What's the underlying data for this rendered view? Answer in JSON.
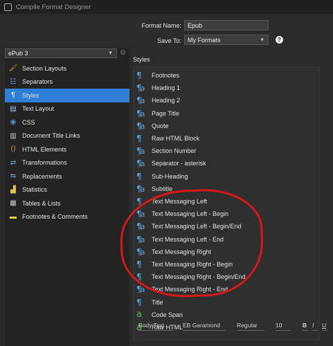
{
  "window": {
    "title": "Compile Format Designer"
  },
  "form": {
    "format_name_label": "Format Name:",
    "format_name_value": "Epub",
    "save_to_label": "Save To:",
    "save_to_value": "My Formats",
    "help_label": "?"
  },
  "sidebar": {
    "format_selected": "ePub 3",
    "items": [
      {
        "label": "Section Layouts",
        "icon": "paint-brush-icon"
      },
      {
        "label": "Separators",
        "icon": "separator-icon"
      },
      {
        "label": "Styles",
        "icon": "styles-icon"
      },
      {
        "label": "Text Layout",
        "icon": "text-layout-icon"
      },
      {
        "label": "CSS",
        "icon": "css-icon"
      },
      {
        "label": "Document Title Links",
        "icon": "document-links-icon"
      },
      {
        "label": "HTML Elements",
        "icon": "html-elements-icon"
      },
      {
        "label": "Transformations",
        "icon": "transformations-icon"
      },
      {
        "label": "Replacements",
        "icon": "replacements-icon"
      },
      {
        "label": "Statistics",
        "icon": "statistics-icon"
      },
      {
        "label": "Tables & Lists",
        "icon": "tables-icon"
      },
      {
        "label": "Footnotes & Comments",
        "icon": "footnotes-icon"
      }
    ]
  },
  "styles": {
    "heading": "Styles",
    "items": [
      {
        "label": "Footnotes",
        "kind": "paragraph"
      },
      {
        "label": "Heading 1",
        "kind": "paragraph-character"
      },
      {
        "label": "Heading 2",
        "kind": "paragraph-character"
      },
      {
        "label": "Page Title",
        "kind": "paragraph-character"
      },
      {
        "label": "Quote",
        "kind": "paragraph-character"
      },
      {
        "label": "Raw HTML Block",
        "kind": "paragraph"
      },
      {
        "label": "Section Number",
        "kind": "paragraph-character"
      },
      {
        "label": "Separator - asterisk",
        "kind": "paragraph-character"
      },
      {
        "label": "Sub-Heading",
        "kind": "paragraph"
      },
      {
        "label": "Subtitle",
        "kind": "paragraph-character"
      },
      {
        "label": "Text Messaging Left",
        "kind": "paragraph"
      },
      {
        "label": "Text Messaging Left - Begin",
        "kind": "paragraph-character"
      },
      {
        "label": "Text Messaging Left - Begin/End",
        "kind": "paragraph-character"
      },
      {
        "label": "Text Messaging Left - End",
        "kind": "paragraph-character"
      },
      {
        "label": "Text Messaging Right",
        "kind": "paragraph-character"
      },
      {
        "label": "Text Messaging Right - Begin",
        "kind": "paragraph"
      },
      {
        "label": "Text Messaging Right - Begin/End",
        "kind": "paragraph"
      },
      {
        "label": "Text Messaging Right - End",
        "kind": "paragraph-character"
      },
      {
        "label": "Title",
        "kind": "paragraph"
      },
      {
        "label": "Code Span",
        "kind": "character"
      },
      {
        "label": "Raw HTML",
        "kind": "character"
      }
    ]
  },
  "toolbar": {
    "style_name": "Body Text",
    "font": "EB Garamond",
    "weight": "Regular",
    "size": "10",
    "bold": "B",
    "italic": "I",
    "underline": "U"
  },
  "colors": {
    "selection": "#2f7fd6",
    "paragraph_icon": "#5aa2dc",
    "character_icon": "#54b84c",
    "annotation": "#d8181a"
  }
}
